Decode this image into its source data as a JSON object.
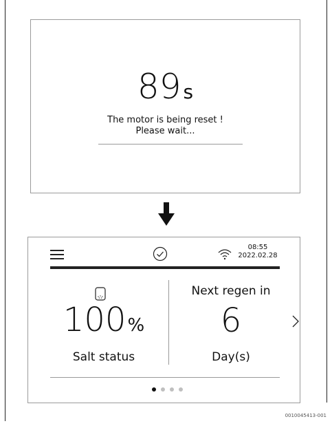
{
  "reset_screen": {
    "countdown_value": "89",
    "countdown_unit": "s",
    "message_line1": "The motor is being reset !",
    "message_line2": "Please wait..."
  },
  "home_screen": {
    "icons": {
      "menu": "hamburger-menu-icon",
      "status": "check-circle-icon",
      "wifi": "wifi-icon",
      "salt": "salt-container-icon",
      "next": "chevron-right-icon"
    },
    "clock": {
      "time": "08:55",
      "date": "2022.02.28"
    },
    "salt": {
      "value": "100",
      "unit": "%",
      "label": "Salt status"
    },
    "regen": {
      "title": "Next regen in",
      "value": "6",
      "unit": "Day(s)"
    },
    "pagination": {
      "pages": 4,
      "active_page": 1
    }
  },
  "figure_ref": "0010045413-001"
}
